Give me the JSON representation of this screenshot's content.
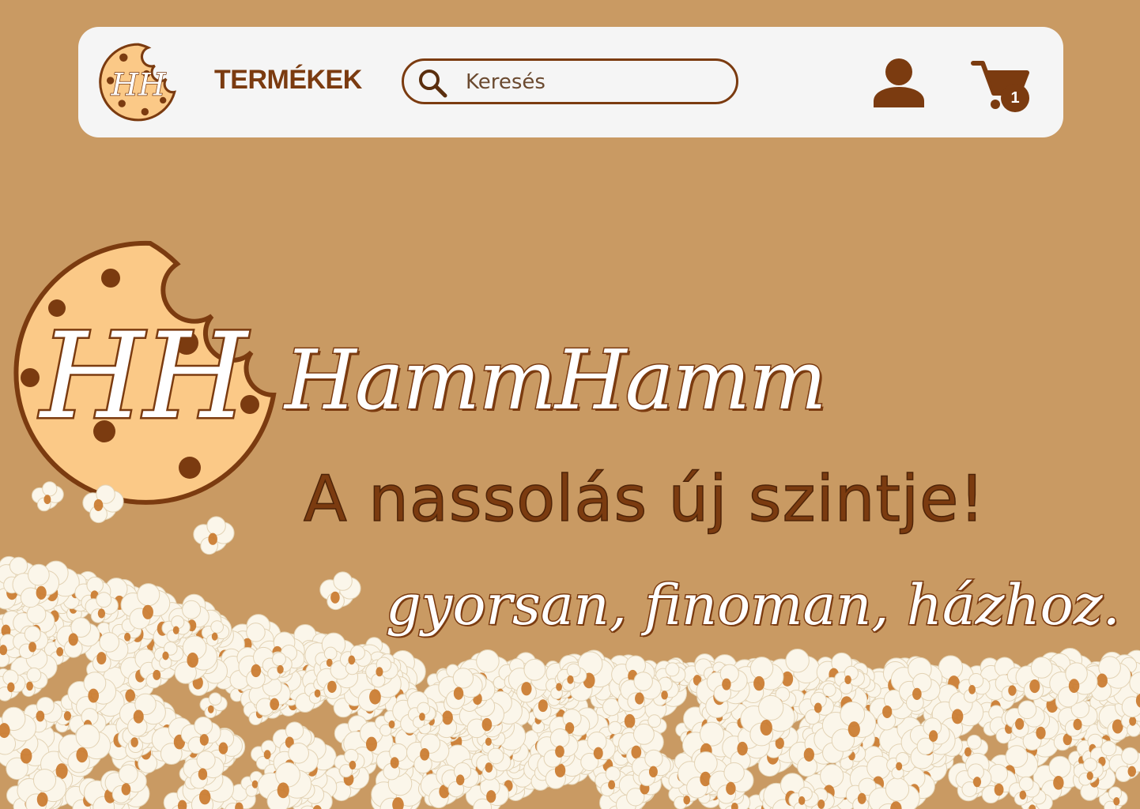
{
  "navbar": {
    "logo_letters": "HH",
    "products_label": "TERMÉKEK",
    "search": {
      "placeholder": "Keresés",
      "value": ""
    },
    "cart": {
      "count": "1"
    }
  },
  "hero": {
    "logo_letters": "HH",
    "brand_name": "HammHamm",
    "tagline": "A nassolás új szintje!",
    "subtagline": "gyorsan, finoman, házhoz."
  },
  "colors": {
    "background": "#c99a63",
    "brand_brown": "#7b3b10",
    "navbar_bg": "#f5f5f5",
    "cookie": "#fbc987"
  },
  "icons": [
    "cookie-logo-icon",
    "search-icon",
    "user-icon",
    "cart-icon",
    "popcorn-decoration"
  ]
}
